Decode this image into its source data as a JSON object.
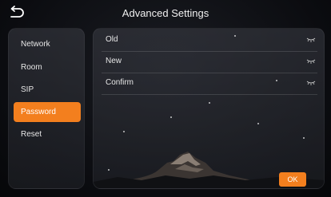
{
  "header": {
    "title": "Advanced Settings"
  },
  "sidebar": {
    "items": [
      {
        "label": "Network"
      },
      {
        "label": "Room"
      },
      {
        "label": "SIP"
      },
      {
        "label": "Password",
        "active": true
      },
      {
        "label": "Reset"
      }
    ]
  },
  "form": {
    "fields": [
      {
        "label": "Old",
        "value": ""
      },
      {
        "label": "New",
        "value": ""
      },
      {
        "label": "Confirm",
        "value": ""
      }
    ],
    "ok_label": "OK"
  },
  "colors": {
    "accent": "#f37f1e",
    "background": "#0b0c10"
  },
  "icons": {
    "back": "back-arrow-icon",
    "visibility": "eye-closed-icon"
  }
}
